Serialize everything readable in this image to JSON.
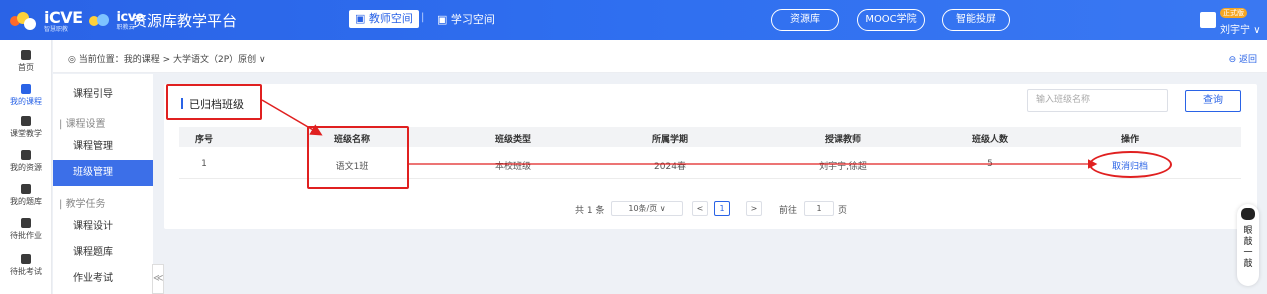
{
  "header": {
    "logo_text": "iCVE",
    "logo_sub": "智慧职教",
    "logo2_text": "icve",
    "logo2_sub": "职教云",
    "site_title": "资源库教学平台",
    "nav_teacher": "教师空间",
    "nav_sep": "|",
    "nav_study": "学习空间",
    "pill_resource": "资源库",
    "pill_mooc": "MOOC学院",
    "pill_smart": "智能投屏",
    "user_badge": "正式版",
    "user_name": "刘宇宁"
  },
  "rail": [
    {
      "label": "首页",
      "icon": "home-icon",
      "active": false
    },
    {
      "label": "我的课程",
      "icon": "course-icon",
      "active": true
    },
    {
      "label": "课堂教学",
      "icon": "classroom-icon",
      "active": false
    },
    {
      "label": "我的资源",
      "icon": "resource-icon",
      "active": false
    },
    {
      "label": "我的题库",
      "icon": "question-bank-icon",
      "active": false
    },
    {
      "label": "待批作业",
      "icon": "homework-icon",
      "active": false
    },
    {
      "label": "待批考试",
      "icon": "exam-icon",
      "active": false
    }
  ],
  "breadcrumb": {
    "text": "当前位置：我的课程 > 大学语文（2P）原创 ∨",
    "back": "返回"
  },
  "subnav": {
    "guide": "课程引导",
    "group_settings": "课程设置",
    "manage": "课程管理",
    "class_manage": "班级管理",
    "group_tasks": "教学任务",
    "design": "课程设计",
    "bank": "课程题库",
    "homework": "作业考试"
  },
  "main": {
    "title": "已归档班级",
    "search_placeholder": "输入班级名称",
    "query_label": "查询",
    "columns": [
      "序号",
      "班级名称",
      "班级类型",
      "所属学期",
      "授课教师",
      "班级人数",
      "操作"
    ],
    "rows": [
      {
        "no": "1",
        "name": "语文1班",
        "type": "本校班级",
        "term": "2024春",
        "teacher": "刘宇宁,徐超",
        "count": "5",
        "action": "取消归档"
      }
    ]
  },
  "pagination": {
    "total": "共 1 条",
    "page_size": "10条/页",
    "prev": "<",
    "current": "1",
    "next": ">",
    "goto_label": "前往",
    "goto_value": "1",
    "page_unit": "页"
  },
  "float_widget": {
    "text": "眼敲一敲"
  },
  "colors": {
    "brand": "#2a63e6",
    "annotation": "#e02020"
  }
}
